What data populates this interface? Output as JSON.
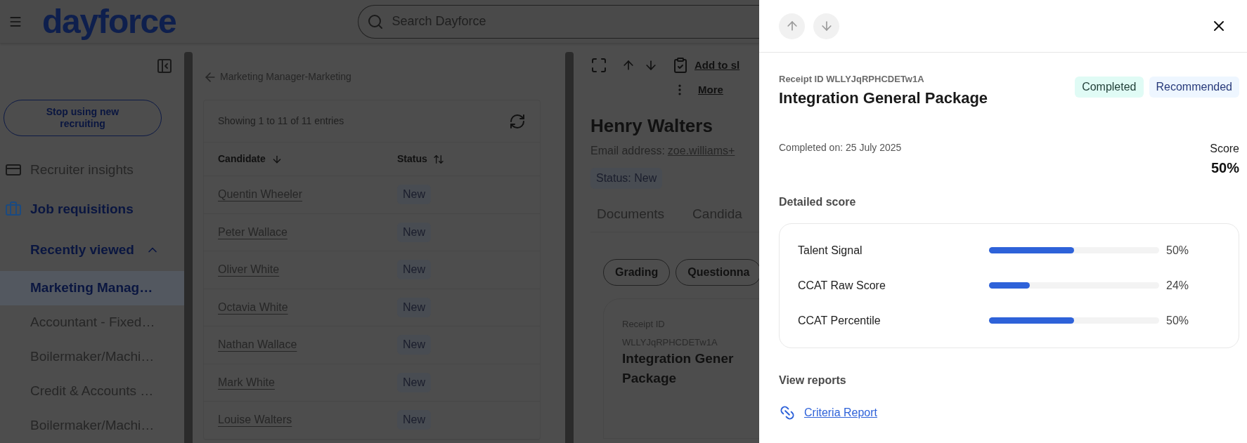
{
  "header": {
    "logo": "dayforce",
    "search": {
      "placeholder": "Search Dayforce"
    }
  },
  "sidebar": {
    "stop_button": "Stop using new recruiting",
    "nav": [
      {
        "label": "Recruiter insights",
        "kind": "insights",
        "selected": false
      },
      {
        "label": "Job requisitions",
        "kind": "briefcase",
        "selected": true
      }
    ],
    "recent": {
      "label": "Recently viewed",
      "expanded": true,
      "items": [
        {
          "label": "Marketing Manag…",
          "selected": true
        },
        {
          "label": "Accountant - Fixed…",
          "selected": false
        },
        {
          "label": "Boilermaker/Machi…",
          "selected": false
        },
        {
          "label": "Credit & Accounts …",
          "selected": false
        },
        {
          "label": "Boilermaker/Machi…",
          "selected": false
        }
      ]
    }
  },
  "list_panel": {
    "breadcrumb": "Marketing Manager-Marketing",
    "summary": "Showing 1 to 11 of 11 entries",
    "columns": [
      {
        "label": "Candidate",
        "kind": "desc"
      },
      {
        "label": "Status",
        "kind": "unsorted"
      }
    ],
    "rows": [
      {
        "candidate": "Quentin Wheeler",
        "status": "New"
      },
      {
        "candidate": "Peter Wallace",
        "status": "New"
      },
      {
        "candidate": "Oliver White",
        "status": "New"
      },
      {
        "candidate": "Octavia White",
        "status": "New"
      },
      {
        "candidate": "Nathan Wallace",
        "status": "New"
      },
      {
        "candidate": "Mark White",
        "status": "New"
      },
      {
        "candidate": "Louise Walters",
        "status": "New"
      }
    ]
  },
  "candidate": {
    "add_link": "Add to sl",
    "more_link": "More",
    "name": "Henry Walters",
    "email_label": "Email address:",
    "email": "zoe.williams+",
    "status": "Status: New",
    "tabs": [
      {
        "label": "Documents",
        "selected": false
      },
      {
        "label": "Candida",
        "selected": false
      }
    ],
    "chips": [
      "Grading",
      "Questionna"
    ],
    "card": {
      "receipt_label": "Receipt ID",
      "receipt_id": "WLLYJqRPHCDETw1A",
      "title_lines": [
        "Integration Gener",
        "Package"
      ]
    }
  },
  "drawer": {
    "nav": [
      {
        "kind": "up",
        "disabled": true
      },
      {
        "kind": "down",
        "disabled": true
      }
    ],
    "receipt": "Receipt ID WLLYJqRPHCDETw1A",
    "title": "Integration General Package",
    "badges": [
      {
        "label": "Completed",
        "kind": "status"
      },
      {
        "label": "Recommended",
        "kind": "recommendation"
      }
    ],
    "completed_on": "Completed on: 25 July 2025",
    "score_label": "Score",
    "score": "50%",
    "detailed_title": "Detailed score",
    "scores": [
      {
        "name": "Talent Signal",
        "level": 0.5,
        "reading": "50%"
      },
      {
        "name": "CCAT Raw Score",
        "level": 0.24,
        "reading": "24%"
      },
      {
        "name": "CCAT Percentile",
        "level": 0.5,
        "reading": "50%"
      }
    ],
    "reports_title": "View reports",
    "reports": [
      {
        "label": "Criteria Report"
      }
    ]
  }
}
